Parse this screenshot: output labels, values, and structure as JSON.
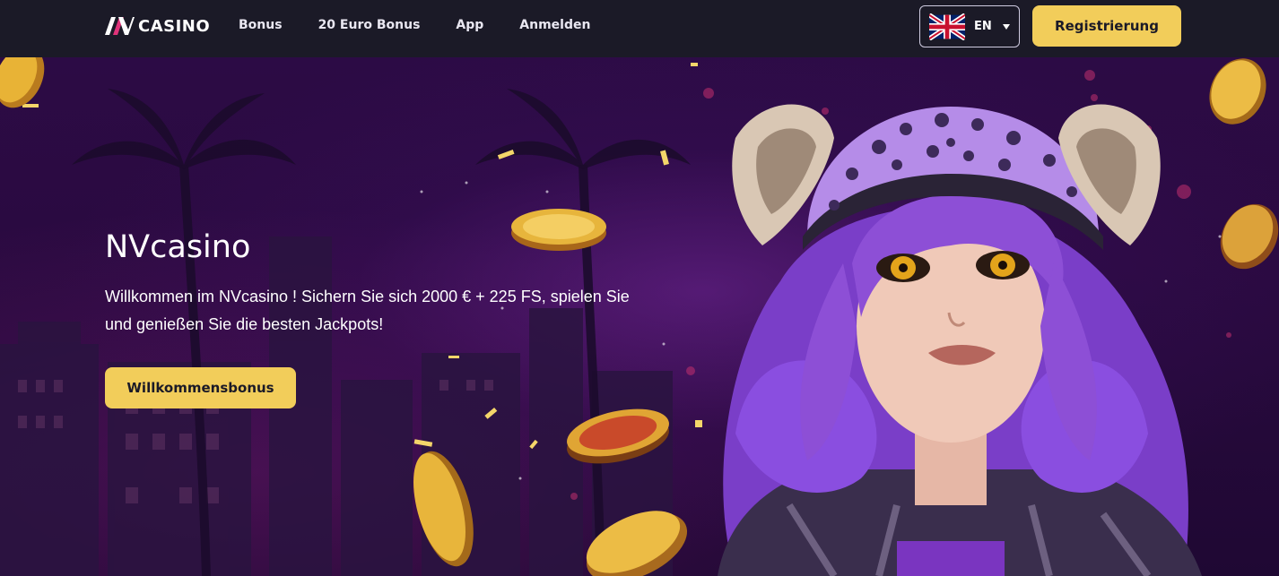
{
  "header": {
    "logo_text": "CASINO",
    "nav": [
      {
        "label": "Bonus"
      },
      {
        "label": "20 Euro Bonus"
      },
      {
        "label": "App"
      },
      {
        "label": "Anmelden"
      }
    ],
    "language": {
      "code": "EN",
      "flag": "uk-flag-icon"
    },
    "register_label": "Registrierung"
  },
  "hero": {
    "title": "NVcasino",
    "text": "Willkommen im NVcasino ! Sichern Sie sich 2000 € + 225 FS, spielen Sie und genießen Sie die besten Jackpots!",
    "button_label": "Willkommensbonus"
  },
  "colors": {
    "accent": "#f2cd5a",
    "nav_bg": "#1b1a27",
    "hero_bg": "#2c0b45"
  }
}
